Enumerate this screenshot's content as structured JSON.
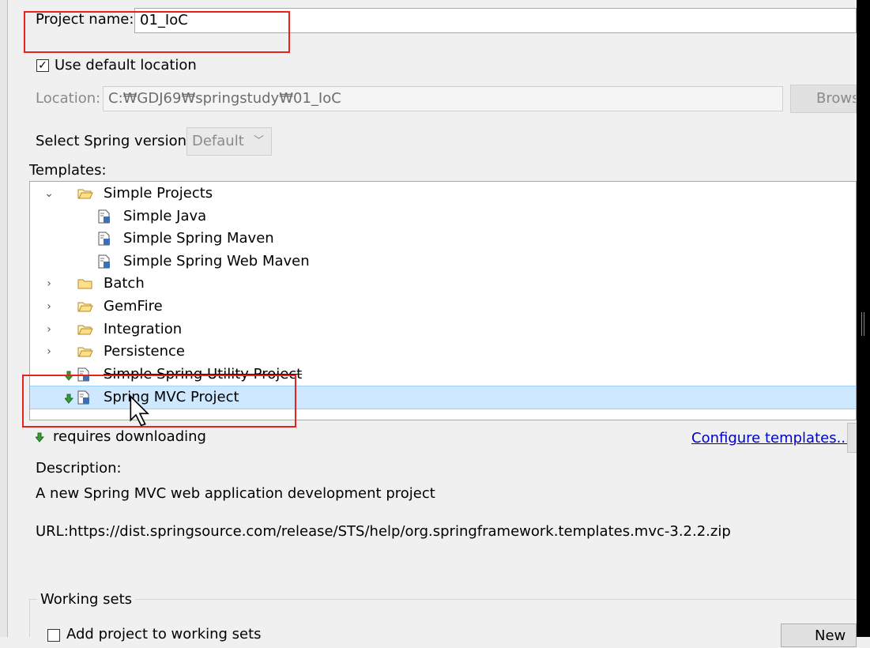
{
  "project_name": {
    "label": "Project name:",
    "value": "01_IoC"
  },
  "default_location": {
    "label": "Use default location",
    "checked": true
  },
  "location": {
    "label": "Location:",
    "value": "C:₩GDJ69₩springstudy₩01_IoC",
    "browse_label": "Brows"
  },
  "spring_version": {
    "label": "Select Spring version:",
    "selected": "Default"
  },
  "templates": {
    "label": "Templates:",
    "items": [
      {
        "label": "Simple Projects",
        "icon": "folder-open-icon",
        "expanded": true
      },
      {
        "label": "Simple Java",
        "icon": "template-file-icon"
      },
      {
        "label": "Simple Spring Maven",
        "icon": "template-file-icon"
      },
      {
        "label": "Simple Spring Web Maven",
        "icon": "template-file-icon"
      },
      {
        "label": "Batch",
        "icon": "folder-icon"
      },
      {
        "label": "GemFire",
        "icon": "folder-icon"
      },
      {
        "label": "Integration",
        "icon": "folder-icon"
      },
      {
        "label": "Persistence",
        "icon": "folder-icon"
      },
      {
        "label": "Simple Spring Utility Project",
        "icon": "download-template-icon"
      },
      {
        "label": "Spring MVC Project",
        "icon": "download-template-icon",
        "selected": true
      }
    ],
    "requires_downloading": "requires downloading",
    "configure_link": "Configure templates..."
  },
  "description": {
    "label": "Description:",
    "text": "A new Spring MVC web application development project",
    "url": "URL:https://dist.springsource.com/release/STS/help/org.springframework.templates.mvc-3.2.2.zip"
  },
  "working_sets": {
    "label": "Working sets",
    "add_label": "Add project to working sets",
    "new_label": "New"
  },
  "colors": {
    "selection": "#cde8ff",
    "highlight": "#e8201e",
    "link": "#0000cc"
  }
}
